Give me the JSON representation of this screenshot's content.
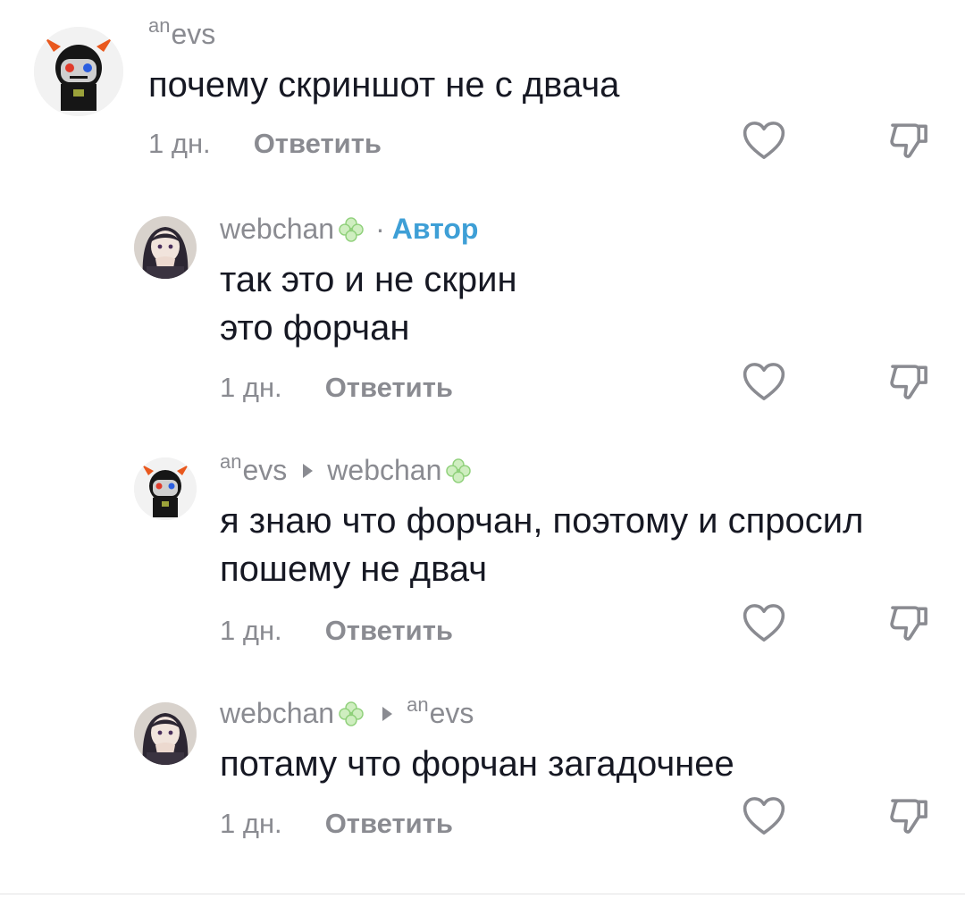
{
  "comments": [
    {
      "username": "evs",
      "username_sup": "an",
      "text": "почему скриншот не с двача",
      "time": "1 дн.",
      "reply_label": "Ответить"
    },
    {
      "username": "webchan",
      "author_badge": "Автор",
      "text": "так это и не скрин\nэто форчан",
      "time": "1 дн.",
      "reply_label": "Ответить"
    },
    {
      "username": "evs",
      "username_sup": "an",
      "reply_to": "webchan",
      "text": "я знаю что форчан, поэтому и спросил\nпошему не двач",
      "time": "1 дн.",
      "reply_label": "Ответить"
    },
    {
      "username": "webchan",
      "reply_to": "evs",
      "reply_to_sup": "an",
      "text": "потаму что форчан загадочнее",
      "time": "1 дн.",
      "reply_label": "Ответить"
    }
  ],
  "icons": {
    "like": "heart-outline-icon",
    "dislike": "thumbs-down-outline-icon",
    "badge": "clover-icon"
  },
  "colors": {
    "author_badge": "#3e9fd6",
    "meta_text": "#8a8b91",
    "main_text": "#161823"
  }
}
